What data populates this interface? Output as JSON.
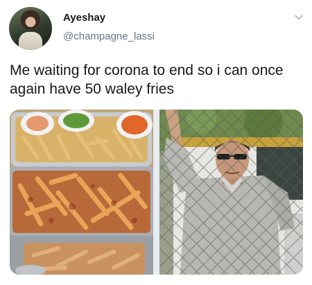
{
  "tweet": {
    "display_name": "Ayeshay",
    "handle": "@champagne_lassi",
    "text": "Me waiting for corona to end so i can once again have 50 waley fries"
  },
  "icons": {
    "menu": "chevron-down-icon"
  },
  "colors": {
    "name_text": "#14171a",
    "handle_text": "#657786",
    "chevron": "#aab8c2"
  }
}
